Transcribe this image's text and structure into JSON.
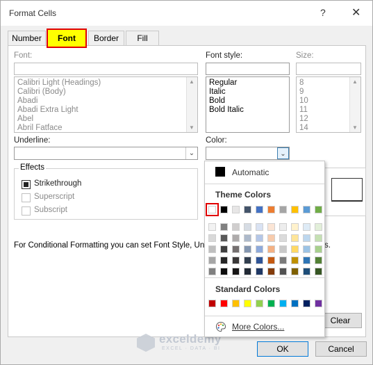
{
  "dialog": {
    "title": "Format Cells",
    "help_glyph": "?",
    "close_glyph": "✕"
  },
  "tabs": [
    {
      "label": "Number"
    },
    {
      "label": "Font"
    },
    {
      "label": "Border"
    },
    {
      "label": "Fill"
    }
  ],
  "font": {
    "label": "Font:",
    "value": "",
    "items": [
      "Calibri Light (Headings)",
      "Calibri (Body)",
      "Abadi",
      "Abadi Extra Light",
      "Abel",
      "Abril Fatface"
    ]
  },
  "font_style": {
    "label": "Font style:",
    "value": "",
    "items": [
      "Regular",
      "Italic",
      "Bold",
      "Bold Italic"
    ]
  },
  "size": {
    "label": "Size:",
    "value": "",
    "items": [
      "8",
      "9",
      "10",
      "11",
      "12",
      "14"
    ]
  },
  "underline": {
    "label": "Underline:",
    "value": ""
  },
  "color": {
    "label": "Color:"
  },
  "effects": {
    "title": "Effects",
    "strikethrough": {
      "label": "Strikethrough",
      "checked": true
    },
    "superscript": {
      "label": "Superscript",
      "checked": false
    },
    "subscript": {
      "label": "Subscript",
      "checked": false
    }
  },
  "note": "For Conditional Formatting you can set Font Style, Un",
  "note_tail": "s.",
  "color_picker": {
    "automatic": "Automatic",
    "theme_heading": "Theme Colors",
    "theme_base": [
      "#ffffff",
      "#000000",
      "#e7e6e6",
      "#44546a",
      "#4472c4",
      "#ed7d31",
      "#a5a5a5",
      "#ffc000",
      "#5b9bd5",
      "#70ad47"
    ],
    "theme_shades": [
      [
        "#f2f2f2",
        "#808080",
        "#d0cece",
        "#d6dce4",
        "#d9e2f3",
        "#fbe5d5",
        "#ededed",
        "#fff2cc",
        "#deebf6",
        "#e2efd9"
      ],
      [
        "#d9d9d9",
        "#595959",
        "#aeabab",
        "#adb9ca",
        "#b4c6e7",
        "#f7cbac",
        "#dbdbdb",
        "#fee599",
        "#bdd7ee",
        "#c5e0b3"
      ],
      [
        "#bfbfbf",
        "#404040",
        "#757070",
        "#8496b0",
        "#8eaadb",
        "#f4b183",
        "#c9c9c9",
        "#ffd965",
        "#9cc3e5",
        "#a8d08d"
      ],
      [
        "#a6a6a6",
        "#262626",
        "#3a3838",
        "#323f4f",
        "#2f5496",
        "#c55a11",
        "#7b7b7b",
        "#bf9000",
        "#2e75b5",
        "#538135"
      ],
      [
        "#808080",
        "#0d0d0d",
        "#171616",
        "#222a35",
        "#1f3864",
        "#833c0b",
        "#525252",
        "#7f6000",
        "#1e4e79",
        "#375623"
      ]
    ],
    "standard_heading": "Standard Colors",
    "standard": [
      "#c00000",
      "#ff0000",
      "#ffc000",
      "#ffff00",
      "#92d050",
      "#00b050",
      "#00b0f0",
      "#0070c0",
      "#002060",
      "#7030a0"
    ],
    "more_colors": "More Colors...",
    "selected_color": "#ffffff"
  },
  "buttons": {
    "clear": "Clear",
    "ok": "OK",
    "cancel": "Cancel"
  },
  "watermark": {
    "name": "exceldemy",
    "tagline": "EXCEL · DATA · BI"
  }
}
